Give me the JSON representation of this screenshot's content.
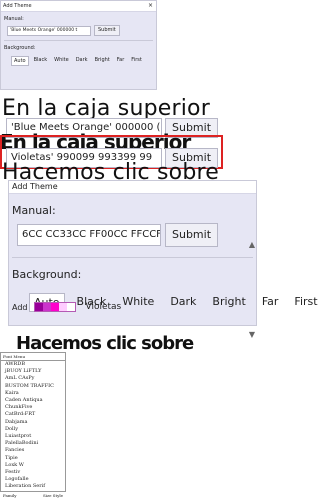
{
  "small_dialog": {
    "title": "Add Theme",
    "manual_label": "Manual:",
    "input_value": "'Blue Meets Orange' 000000 t",
    "submit_label": "Submit",
    "background_label": "Background:",
    "background_options": [
      "Auto",
      "Black",
      "White",
      "Dark",
      "Bright",
      "Far",
      "First"
    ]
  },
  "large_text": {
    "line1": "En la caja superior",
    "line2": "Hacemos clic sobre",
    "input_value_top": "'Blue Meets Orange' 000000 (",
    "submit_top": "Submit",
    "input_value_bottom": "Violetas' 990099 993399 99",
    "submit_bottom": "Submit"
  },
  "large_dialog": {
    "title": "Add Theme",
    "manual_label": "Manual:",
    "input_value": "6CC CC33CC FF00CC FFCCFF",
    "submit_label": "Submit",
    "background_label": "Background:",
    "background_options": [
      "Auto",
      "Black",
      "White",
      "Dark",
      "Bright",
      "Far",
      "First"
    ],
    "add_label": "Add",
    "theme_name": "Violetas",
    "swatch_colors": [
      "#990099",
      "#cc33cc",
      "#ff00cc",
      "#ffccff",
      "#ffffff"
    ]
  },
  "font_panel": {
    "title": "Font Menu",
    "fonts": [
      "AWRDB",
      "jBUOY LiFTLY",
      "AmL CAsPy",
      "BUSTOM TRAFFIC",
      "Kaira",
      "Caden Antiqua",
      "ChunkFive",
      "CatBrd:FRT",
      "Dabjama",
      "Dolly",
      "Luiastprot",
      "PalellaBodini",
      "Fancies",
      "Tipie",
      "Loxk W",
      "Festiv",
      "Logofalle",
      "Liberation Serif"
    ],
    "footer_left": "Family",
    "footer_right": "Size Style"
  },
  "scroll": {
    "up": "▲",
    "down": "▼"
  }
}
